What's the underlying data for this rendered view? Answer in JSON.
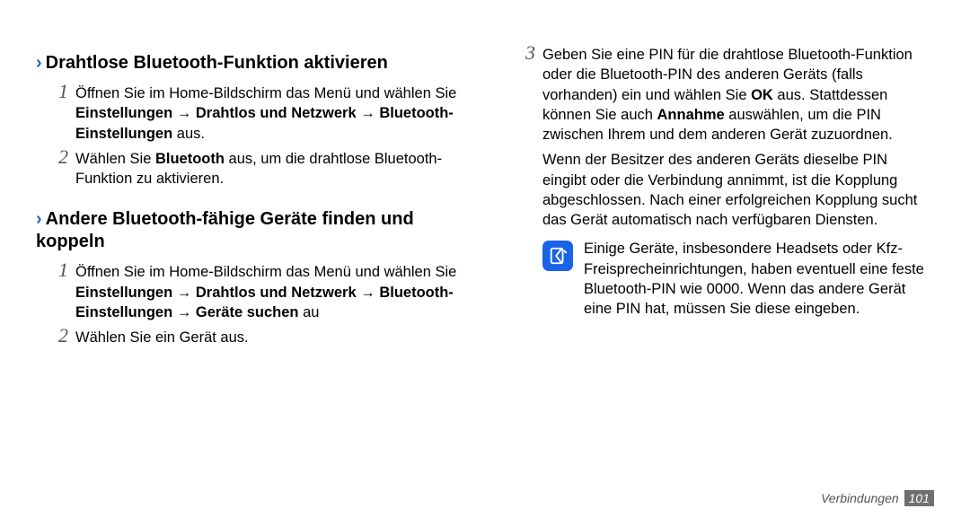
{
  "col1": {
    "sec1": {
      "heading": "Drahtlose Bluetooth-Funktion aktivieren",
      "step1_open": "Öffnen Sie im Home-Bildschirm das Menü und wählen Sie ",
      "step1_path_a": "Einstellungen",
      "step1_path_b": "Drahtlos und Netzwerk",
      "step1_path_c": "Bluetooth-Einstellungen",
      "step1_out": " aus.",
      "step2_a": "Wählen Sie ",
      "step2_b": "Bluetooth",
      "step2_c": " aus, um die drahtlose Bluetooth-Funktion zu aktivieren."
    },
    "sec2": {
      "heading": "Andere Bluetooth-fähige Geräte finden und koppeln",
      "step1_open": "Öffnen Sie im Home-Bildschirm das Menü und wählen Sie ",
      "step1_path_a": "Einstellungen",
      "step1_path_b": "Drahtlos und Netzwerk",
      "step1_path_c": "Bluetooth-Einstellungen",
      "step1_path_d": "Geräte suchen",
      "step1_out": " au",
      "step2": "Wählen Sie ein Gerät aus."
    }
  },
  "col2": {
    "step3_a": "Geben Sie eine PIN für die drahtlose Bluetooth-Funktion oder die Bluetooth-PIN des anderen Geräts (falls vorhanden) ein und wählen Sie ",
    "step3_ok": "OK",
    "step3_b": " aus. Stattdessen können Sie auch ",
    "step3_ann": "Annahme",
    "step3_c": " auswählen, um die PIN zwischen Ihrem und dem anderen Gerät zuzuordnen.",
    "cont": "Wenn der Besitzer des anderen Geräts dieselbe PIN eingibt oder die Verbindung annimmt, ist die Kopplung abgeschlossen. Nach einer erfolgreichen Kopplung sucht das Gerät automatisch nach verfügbaren Diensten.",
    "note": "Einige Geräte, insbesondere Headsets oder Kfz-Freisprecheinrichtungen, haben eventuell eine feste Bluetooth-PIN wie 0000. Wenn das andere Gerät eine PIN hat, müssen Sie diese eingeben."
  },
  "footer": {
    "label": "Verbindungen",
    "page": "101"
  },
  "nums": {
    "n1": "1",
    "n2": "2",
    "n3": "3"
  },
  "arrow": " → "
}
